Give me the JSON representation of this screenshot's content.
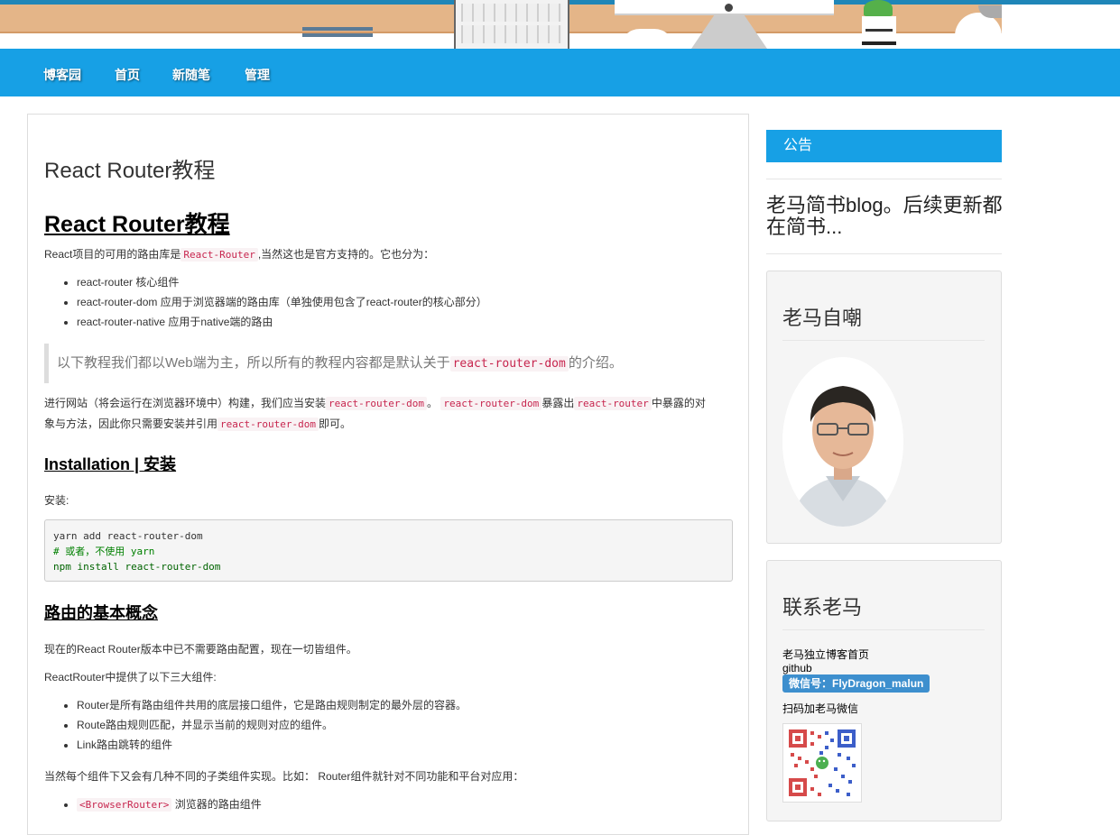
{
  "nav": {
    "items": [
      "博客园",
      "首页",
      "新随笔",
      "管理"
    ]
  },
  "post": {
    "title": "React Router教程",
    "h2": "React Router教程",
    "intro_before": "React项目的可用的路由库是",
    "intro_code": "React-Router",
    "intro_after": ",当然这也是官方支持的。它也分为：",
    "packages": [
      "react-router 核心组件",
      "react-router-dom 应用于浏览器端的路由库（单独使用包含了react-router的核心部分）",
      "react-router-native 应用于native端的路由"
    ],
    "quote_before": "以下教程我们都以Web端为主，所以所有的教程内容都是默认关于",
    "quote_code": "react-router-dom",
    "quote_after": "的介绍。",
    "para2": {
      "t1": "进行网站（将会运行在浏览器环境中）构建，我们应当安装",
      "c1": "react-router-dom",
      "t2": "。",
      "c2": "react-router-dom",
      "t3": "暴露出",
      "c3": "react-router",
      "t4": "中暴露的对",
      "t5": "象与方法，因此你只需要安装并引用",
      "c4": "react-router-dom",
      "t6": "即可。"
    },
    "installation_heading": "Installation | 安装",
    "install_label": "安装:",
    "code_lines": [
      "yarn add react-router-dom",
      "# 或者，不使用 yarn",
      "npm install react-router-dom"
    ],
    "concepts_heading": "路由的基本概念",
    "concepts_p1": "现在的React Router版本中已不需要路由配置，现在一切皆组件。",
    "concepts_p2": "ReactRouter中提供了以下三大组件:",
    "components": [
      "Router是所有路由组件共用的底层接口组件，它是路由规则制定的最外层的容器。",
      "Route路由规则匹配，并显示当前的规则对应的组件。",
      "Link路由跳转的组件"
    ],
    "concepts_p3": "当然每个组件下又会有几种不同的子类组件实现。比如： Router组件就针对不同功能和平台对应用：",
    "browser_router_code": "<BrowserRouter>",
    "browser_router_text": "浏览器的路由组件"
  },
  "sidebar": {
    "notice_heading": "公告",
    "notice_text": "老马简书blog。后续更新都在简书...",
    "profile_title": "老马自嘲",
    "contact_title": "联系老马",
    "contact_home": "老马独立博客首页",
    "contact_github": "github",
    "contact_wechat": "微信号：FlyDragon_malun",
    "contact_scan": "扫码加老马微信"
  },
  "colors": {
    "nav_bg": "#17a0e5",
    "inline_code": "#c7254e",
    "badge": "#3d8fce"
  }
}
